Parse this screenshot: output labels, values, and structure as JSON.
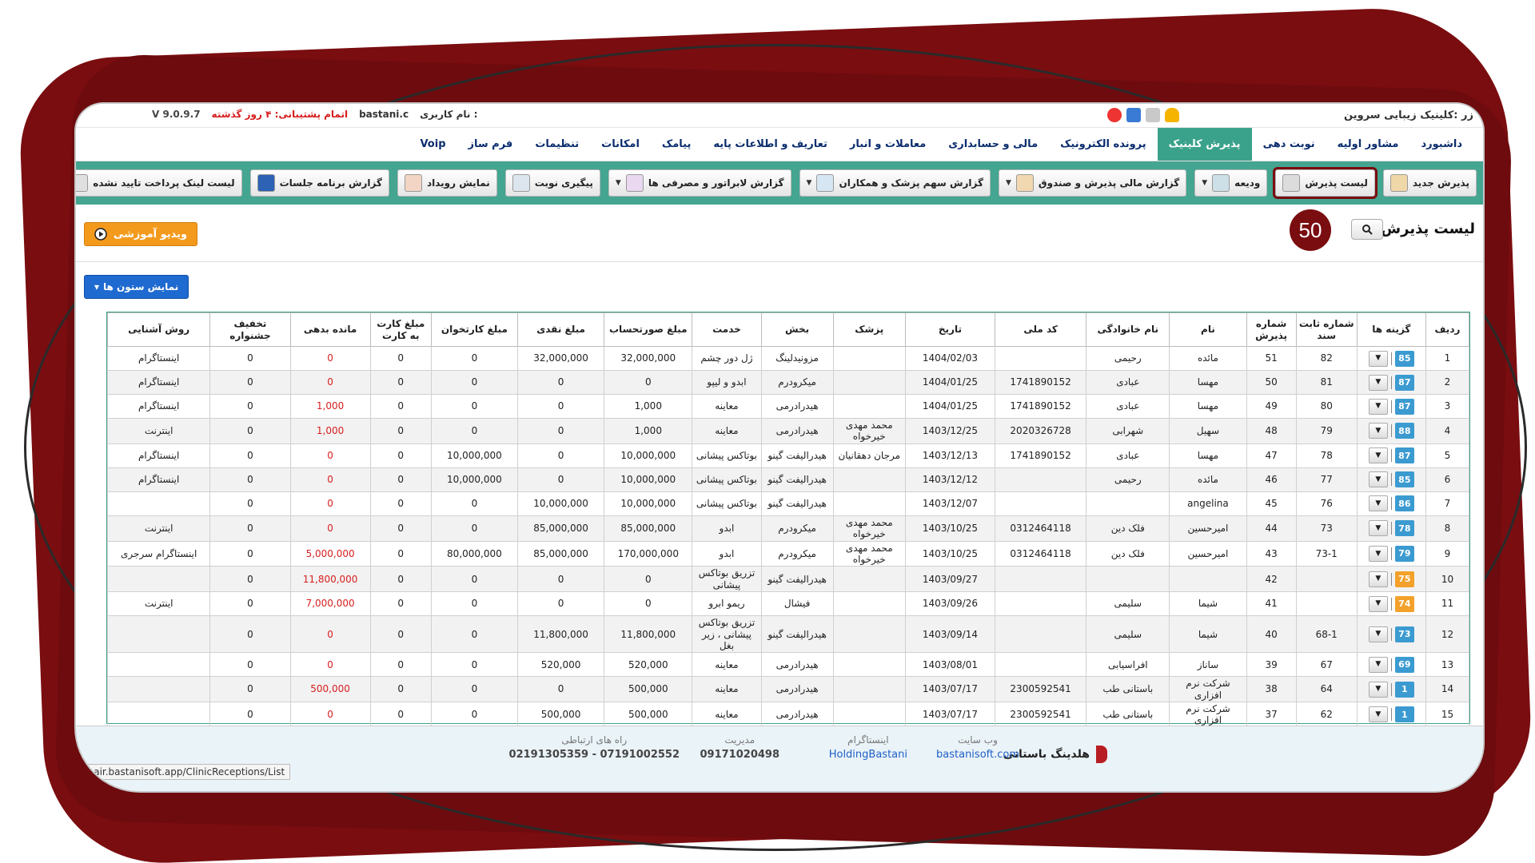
{
  "app": {
    "title": "زر :کلینیک زیبایی سروین",
    "version": "V 9.0.9.7",
    "support_expire": "اتمام پشتیبانی: ۴ روز گذشته",
    "username_label": "نام کاربری :",
    "username": "bastani.c"
  },
  "menu": {
    "items": [
      {
        "label": "داشبورد",
        "active": false
      },
      {
        "label": "مشاور اولیه",
        "active": false
      },
      {
        "label": "نوبت دهی",
        "active": false
      },
      {
        "label": "پذیرش کلینیک",
        "active": true
      },
      {
        "label": "پرونده الکترونیک",
        "active": false
      },
      {
        "label": "مالی و حسابداری",
        "active": false
      },
      {
        "label": "معاملات و انبار",
        "active": false
      },
      {
        "label": "تعاریف و اطلاعات پایه",
        "active": false
      },
      {
        "label": "پیامک",
        "active": false
      },
      {
        "label": "امکانات",
        "active": false
      },
      {
        "label": "تنظیمات",
        "active": false
      },
      {
        "label": "فرم ساز",
        "active": false
      },
      {
        "label": "Voip",
        "active": false
      }
    ]
  },
  "toolbar": {
    "buttons": [
      {
        "label": "پذیرش جدید",
        "caret": false,
        "highlight": false,
        "icon": "new-reception-icon",
        "color": "#f0d7a8"
      },
      {
        "label": "لیست پذیرش",
        "caret": false,
        "highlight": true,
        "icon": "list-icon",
        "color": "#dcdcdc"
      },
      {
        "label": "ودیعه",
        "caret": true,
        "highlight": false,
        "icon": "deposit-icon",
        "color": "#cde0e8"
      },
      {
        "label": "گزارش مالی پذیرش و صندوق",
        "caret": true,
        "highlight": false,
        "icon": "cash-report-icon",
        "color": "#f2d8b0"
      },
      {
        "label": "گزارش سهم پزشک و همکاران",
        "caret": true,
        "highlight": false,
        "icon": "doctor-share-icon",
        "color": "#d6e6f2"
      },
      {
        "label": "گزارش لابراتور و مصرفی ها",
        "caret": true,
        "highlight": false,
        "icon": "lab-report-icon",
        "color": "#e9d8f0"
      },
      {
        "label": "پیگیری نوبت",
        "caret": false,
        "highlight": false,
        "icon": "followup-icon",
        "color": "#dde6ee"
      },
      {
        "label": "نمایش رویداد",
        "caret": false,
        "highlight": false,
        "icon": "calendar-icon",
        "color": "#f2d5c5"
      },
      {
        "label": "گزارش برنامه جلسات",
        "caret": false,
        "highlight": false,
        "icon": "session-icon",
        "color": "#2d62b5"
      },
      {
        "label": "لیست لینک پرداخت تایید نشده",
        "caret": false,
        "highlight": false,
        "icon": "link-icon",
        "color": "#e0e0e0"
      }
    ]
  },
  "page": {
    "title": "لیست پذیرش",
    "badge": "50",
    "video_label": "ویدیو آموزشی",
    "columns_button": "نمایش ستون ها"
  },
  "table": {
    "headers": [
      "ردیف",
      "گزینه ها",
      "شماره ثابت سند",
      "شماره پذیرش",
      "نام",
      "نام خانوادگی",
      "کد ملی",
      "تاریخ",
      "پزشک",
      "بخش",
      "خدمت",
      "مبلغ صورتحساب",
      "مبلغ نقدی",
      "مبلغ کارتخوان",
      "مبلغ کارت به کارت",
      "مانده بدهی",
      "تخفیف جشنواره",
      "روش آشنایی"
    ],
    "rows": [
      {
        "row": "1",
        "opt": "85",
        "opt_color": "blue",
        "doc": "82",
        "rec": "51",
        "fname": "مائده",
        "lname": "رحیمی",
        "nid": "",
        "date": "1404/02/03",
        "doctor": "",
        "dept": "مزونیدلینگ",
        "service": "ژل دور چشم",
        "bill": "32,000,000",
        "cash": "32,000,000",
        "pos": "0",
        "c2c": "0",
        "debt": "0",
        "disc": "0",
        "source": "اینستاگرام"
      },
      {
        "row": "2",
        "opt": "87",
        "opt_color": "blue",
        "doc": "81",
        "rec": "50",
        "fname": "مهسا",
        "lname": "عبادی",
        "nid": "1741890152",
        "date": "1404/01/25",
        "doctor": "",
        "dept": "میکرودرم",
        "service": "ابدو و لیپو",
        "bill": "0",
        "cash": "0",
        "pos": "0",
        "c2c": "0",
        "debt": "0",
        "disc": "0",
        "source": "اینستاگرام"
      },
      {
        "row": "3",
        "opt": "87",
        "opt_color": "blue",
        "doc": "80",
        "rec": "49",
        "fname": "مهسا",
        "lname": "عبادی",
        "nid": "1741890152",
        "date": "1404/01/25",
        "doctor": "",
        "dept": "هیدرادرمی",
        "service": "معاینه",
        "bill": "1,000",
        "cash": "0",
        "pos": "0",
        "c2c": "0",
        "debt": "1,000",
        "disc": "0",
        "source": "اینستاگرام"
      },
      {
        "row": "4",
        "opt": "88",
        "opt_color": "blue",
        "doc": "79",
        "rec": "48",
        "fname": "سهیل",
        "lname": "شهرابی",
        "nid": "2020326728",
        "date": "1403/12/25",
        "doctor": "محمد مهدی خیرخواه",
        "dept": "هیدرادرمی",
        "service": "معاینه",
        "bill": "1,000",
        "cash": "0",
        "pos": "0",
        "c2c": "0",
        "debt": "1,000",
        "disc": "0",
        "source": "اینترنت"
      },
      {
        "row": "5",
        "opt": "87",
        "opt_color": "blue",
        "doc": "78",
        "rec": "47",
        "fname": "مهسا",
        "lname": "عبادی",
        "nid": "1741890152",
        "date": "1403/12/13",
        "doctor": "مرجان دهقانیان",
        "dept": "هیدرالیفت گینو",
        "service": "بوتاکس پیشانی",
        "bill": "10,000,000",
        "cash": "0",
        "pos": "10,000,000",
        "c2c": "0",
        "debt": "0",
        "disc": "0",
        "source": "اینستاگرام"
      },
      {
        "row": "6",
        "opt": "85",
        "opt_color": "blue",
        "doc": "77",
        "rec": "46",
        "fname": "مائده",
        "lname": "رحیمی",
        "nid": "",
        "date": "1403/12/12",
        "doctor": "",
        "dept": "هیدرالیفت گینو",
        "service": "بوتاکس پیشانی",
        "bill": "10,000,000",
        "cash": "0",
        "pos": "10,000,000",
        "c2c": "0",
        "debt": "0",
        "disc": "0",
        "source": "اینستاگرام"
      },
      {
        "row": "7",
        "opt": "86",
        "opt_color": "blue",
        "doc": "76",
        "rec": "45",
        "fname": "angelina",
        "lname": "",
        "nid": "",
        "date": "1403/12/07",
        "doctor": "",
        "dept": "هیدرالیفت گینو",
        "service": "بوتاکس پیشانی",
        "bill": "10,000,000",
        "cash": "10,000,000",
        "pos": "0",
        "c2c": "0",
        "debt": "0",
        "disc": "0",
        "source": ""
      },
      {
        "row": "8",
        "opt": "78",
        "opt_color": "blue",
        "doc": "73",
        "rec": "44",
        "fname": "امیرحسین",
        "lname": "فلک دین",
        "nid": "0312464118",
        "date": "1403/10/25",
        "doctor": "محمد مهدی خیرخواه",
        "dept": "میکرودرم",
        "service": "ابدو",
        "bill": "85,000,000",
        "cash": "85,000,000",
        "pos": "0",
        "c2c": "0",
        "debt": "0",
        "disc": "0",
        "source": "اینترنت"
      },
      {
        "row": "9",
        "opt": "79",
        "opt_color": "blue",
        "doc": "73-1",
        "rec": "43",
        "fname": "امیرحسین",
        "lname": "فلک دین",
        "nid": "0312464118",
        "date": "1403/10/25",
        "doctor": "محمد مهدی خیرخواه",
        "dept": "میکرودرم",
        "service": "ابدو",
        "bill": "170,000,000",
        "cash": "85,000,000",
        "pos": "80,000,000",
        "c2c": "0",
        "debt": "5,000,000",
        "disc": "0",
        "source": "اینستاگرام سرجری"
      },
      {
        "row": "10",
        "opt": "75",
        "opt_color": "orange",
        "doc": "",
        "rec": "42",
        "fname": "",
        "lname": "",
        "nid": "",
        "date": "1403/09/27",
        "doctor": "",
        "dept": "هیدرالیفت گینو",
        "service": "تزریق بوتاکس پیشانی",
        "bill": "0",
        "cash": "0",
        "pos": "0",
        "c2c": "0",
        "debt": "11,800,000",
        "disc": "0",
        "source": ""
      },
      {
        "row": "11",
        "opt": "74",
        "opt_color": "orange",
        "doc": "",
        "rec": "41",
        "fname": "شیما",
        "lname": "سلیمی",
        "nid": "",
        "date": "1403/09/26",
        "doctor": "",
        "dept": "فیشال",
        "service": "ریمو ابرو",
        "bill": "0",
        "cash": "0",
        "pos": "0",
        "c2c": "0",
        "debt": "7,000,000",
        "disc": "0",
        "source": "اینترنت"
      },
      {
        "row": "12",
        "opt": "73",
        "opt_color": "blue",
        "doc": "68-1",
        "rec": "40",
        "fname": "شیما",
        "lname": "سلیمی",
        "nid": "",
        "date": "1403/09/14",
        "doctor": "",
        "dept": "هیدرالیفت گینو",
        "service": "تزریق بوتاکس پیشانی ، زیر بغل",
        "bill": "11,800,000",
        "cash": "11,800,000",
        "pos": "0",
        "c2c": "0",
        "debt": "0",
        "disc": "0",
        "source": ""
      },
      {
        "row": "13",
        "opt": "69",
        "opt_color": "blue",
        "doc": "67",
        "rec": "39",
        "fname": "ساناز",
        "lname": "افراسیابی",
        "nid": "",
        "date": "1403/08/01",
        "doctor": "",
        "dept": "هیدرادرمی",
        "service": "معاینه",
        "bill": "520,000",
        "cash": "520,000",
        "pos": "0",
        "c2c": "0",
        "debt": "0",
        "disc": "0",
        "source": ""
      },
      {
        "row": "14",
        "opt": "1",
        "opt_color": "blue",
        "doc": "64",
        "rec": "38",
        "fname": "شرکت نرم افزاری",
        "lname": "باستانی طب",
        "nid": "2300592541",
        "date": "1403/07/17",
        "doctor": "",
        "dept": "هیدرادرمی",
        "service": "معاینه",
        "bill": "500,000",
        "cash": "0",
        "pos": "0",
        "c2c": "0",
        "debt": "500,000",
        "disc": "0",
        "source": ""
      },
      {
        "row": "15",
        "opt": "1",
        "opt_color": "blue",
        "doc": "62",
        "rec": "37",
        "fname": "شرکت نرم افزاری",
        "lname": "باستانی طب",
        "nid": "2300592541",
        "date": "1403/07/17",
        "doctor": "",
        "dept": "هیدرادرمی",
        "service": "معاینه",
        "bill": "500,000",
        "cash": "500,000",
        "pos": "0",
        "c2c": "0",
        "debt": "0",
        "disc": "0",
        "source": ""
      }
    ]
  },
  "footer": {
    "brand": "هلدینگ باستانی",
    "website_label": "وب سایت",
    "website": "bastanisoft.com",
    "instagram_label": "اینستاگرام",
    "instagram": "HoldingBastani",
    "management_label": "مدیریت",
    "management": "09171020498",
    "contact_label": "راه های ارتباطی",
    "contact": "07191002552 - 02191305359",
    "status_url": "nhair.bastanisoft.app/ClinicReceptions/List"
  },
  "colors": {
    "maroon": "#7a0d10",
    "teal": "#44a591",
    "active_tab": "#3aa28b",
    "link_blue": "#1f5fc7",
    "debt_red": "#d71d1d",
    "badge_blue": "#3b9bd1",
    "badge_orange": "#f3a12b"
  }
}
